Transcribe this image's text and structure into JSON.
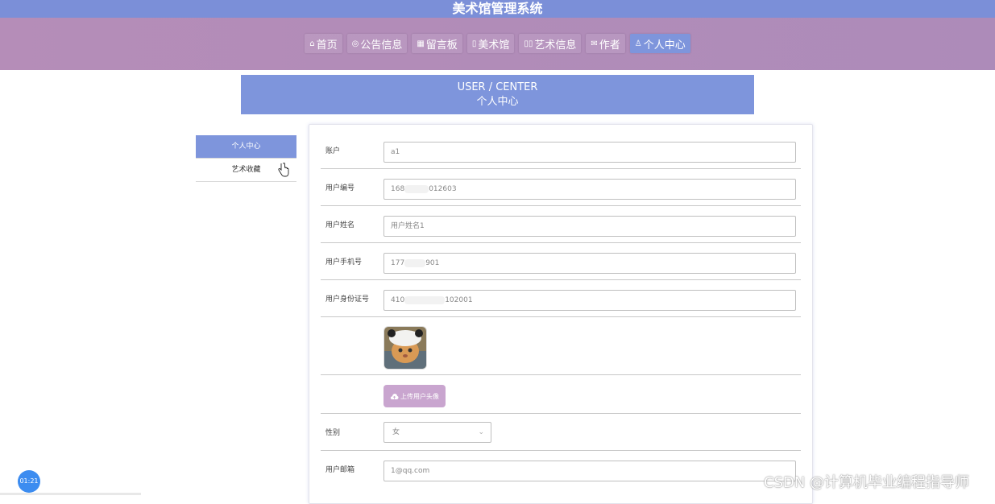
{
  "app": {
    "title": "美术馆管理系统"
  },
  "nav": [
    {
      "icon": "home-icon",
      "glyph": "⌂",
      "label": "首页",
      "active": false
    },
    {
      "icon": "announce-icon",
      "glyph": "◎",
      "label": "公告信息",
      "active": false
    },
    {
      "icon": "board-icon",
      "glyph": "▦",
      "label": "留言板",
      "active": false
    },
    {
      "icon": "gallery-icon",
      "glyph": "▯",
      "label": "美术馆",
      "active": false
    },
    {
      "icon": "art-icon",
      "glyph": "▯▯",
      "label": "艺术信息",
      "active": false
    },
    {
      "icon": "author-icon",
      "glyph": "✉",
      "label": "作者",
      "active": false
    },
    {
      "icon": "user-icon",
      "glyph": "♙",
      "label": "个人中心",
      "active": true
    }
  ],
  "header": {
    "en": "USER / CENTER",
    "cn": "个人中心"
  },
  "sidebar": {
    "items": [
      {
        "label": "个人中心",
        "active": true
      },
      {
        "label": "艺术收藏",
        "active": false
      }
    ]
  },
  "form": {
    "account": {
      "label": "账户",
      "value": "a1"
    },
    "user_no": {
      "label": "用户编号",
      "value_start": "168",
      "value_end": "012603"
    },
    "user_name": {
      "label": "用户姓名",
      "value": "用户姓名1"
    },
    "phone": {
      "label": "用户手机号",
      "value_start": "177",
      "value_end": "901"
    },
    "id_card": {
      "label": "用户身份证号",
      "value_start": "410",
      "value_end": "102001"
    },
    "upload": {
      "label": "上传用户头像",
      "icon": "cloud-upload-icon"
    },
    "gender": {
      "label": "性别",
      "value": "女"
    },
    "email": {
      "label": "用户邮箱",
      "value": "1@qq.com"
    }
  },
  "overlay": {
    "timer": "01:21",
    "watermark": "CSDN @计算机毕业编程指导师"
  },
  "colors": {
    "topbar": "#7b8fd8",
    "nav_band": "#b58db8",
    "accent": "#7e95dc",
    "upload_button": "#c9a5cf"
  }
}
